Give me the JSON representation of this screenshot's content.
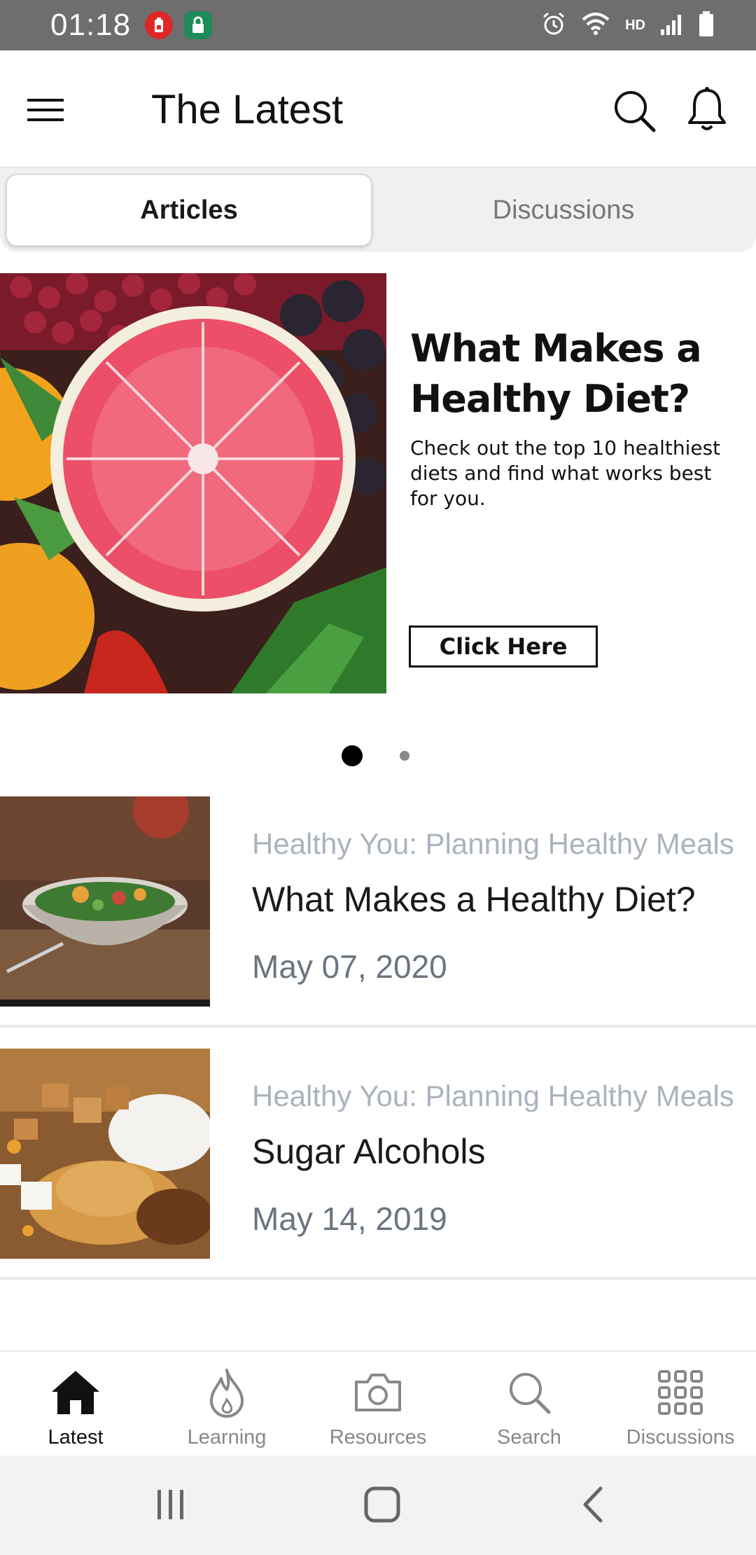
{
  "status_bar": {
    "time": "01:18",
    "network": "HD"
  },
  "app_bar": {
    "title": "The Latest"
  },
  "tabs": [
    {
      "label": "Articles",
      "selected": true
    },
    {
      "label": "Discussions",
      "selected": false
    }
  ],
  "banner": {
    "title": "What Makes a Healthy Diet?",
    "description": "Check out the top 10 healthiest diets and find what works best for you.",
    "button_label": "Click Here",
    "page_index": 1,
    "page_count": 2
  },
  "articles": [
    {
      "category": "Healthy You: Planning Healthy Meals",
      "title": "What Makes a Healthy Diet?",
      "date": "May 07, 2020"
    },
    {
      "category": "Healthy You: Planning Healthy Meals",
      "title": "Sugar Alcohols",
      "date": "May 14, 2019"
    }
  ],
  "bottom_nav": [
    {
      "label": "Latest",
      "icon": "home-icon",
      "active": true
    },
    {
      "label": "Learning",
      "icon": "flame-icon",
      "active": false
    },
    {
      "label": "Resources",
      "icon": "camera-icon",
      "active": false
    },
    {
      "label": "Search",
      "icon": "search-icon",
      "active": false
    },
    {
      "label": "Discussions",
      "icon": "grid-icon",
      "active": false
    }
  ],
  "colors": {
    "status_bar": "#6e6e6e",
    "category_text": "#aab3bd",
    "date_text": "#6b7580",
    "nav_active": "#111111",
    "nav_inactive": "#888888"
  }
}
